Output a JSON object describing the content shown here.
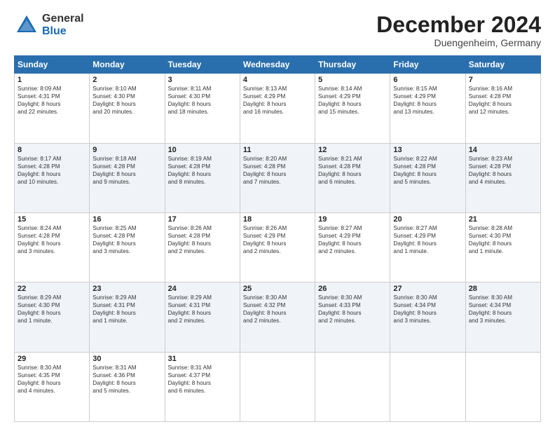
{
  "header": {
    "logo_general": "General",
    "logo_blue": "Blue",
    "month_title": "December 2024",
    "location": "Duengenheim, Germany"
  },
  "days_of_week": [
    "Sunday",
    "Monday",
    "Tuesday",
    "Wednesday",
    "Thursday",
    "Friday",
    "Saturday"
  ],
  "weeks": [
    [
      {
        "day": "1",
        "lines": [
          "Sunrise: 8:09 AM",
          "Sunset: 4:31 PM",
          "Daylight: 8 hours",
          "and 22 minutes."
        ]
      },
      {
        "day": "2",
        "lines": [
          "Sunrise: 8:10 AM",
          "Sunset: 4:30 PM",
          "Daylight: 8 hours",
          "and 20 minutes."
        ]
      },
      {
        "day": "3",
        "lines": [
          "Sunrise: 8:11 AM",
          "Sunset: 4:30 PM",
          "Daylight: 8 hours",
          "and 18 minutes."
        ]
      },
      {
        "day": "4",
        "lines": [
          "Sunrise: 8:13 AM",
          "Sunset: 4:29 PM",
          "Daylight: 8 hours",
          "and 16 minutes."
        ]
      },
      {
        "day": "5",
        "lines": [
          "Sunrise: 8:14 AM",
          "Sunset: 4:29 PM",
          "Daylight: 8 hours",
          "and 15 minutes."
        ]
      },
      {
        "day": "6",
        "lines": [
          "Sunrise: 8:15 AM",
          "Sunset: 4:29 PM",
          "Daylight: 8 hours",
          "and 13 minutes."
        ]
      },
      {
        "day": "7",
        "lines": [
          "Sunrise: 8:16 AM",
          "Sunset: 4:28 PM",
          "Daylight: 8 hours",
          "and 12 minutes."
        ]
      }
    ],
    [
      {
        "day": "8",
        "lines": [
          "Sunrise: 8:17 AM",
          "Sunset: 4:28 PM",
          "Daylight: 8 hours",
          "and 10 minutes."
        ]
      },
      {
        "day": "9",
        "lines": [
          "Sunrise: 8:18 AM",
          "Sunset: 4:28 PM",
          "Daylight: 8 hours",
          "and 9 minutes."
        ]
      },
      {
        "day": "10",
        "lines": [
          "Sunrise: 8:19 AM",
          "Sunset: 4:28 PM",
          "Daylight: 8 hours",
          "and 8 minutes."
        ]
      },
      {
        "day": "11",
        "lines": [
          "Sunrise: 8:20 AM",
          "Sunset: 4:28 PM",
          "Daylight: 8 hours",
          "and 7 minutes."
        ]
      },
      {
        "day": "12",
        "lines": [
          "Sunrise: 8:21 AM",
          "Sunset: 4:28 PM",
          "Daylight: 8 hours",
          "and 6 minutes."
        ]
      },
      {
        "day": "13",
        "lines": [
          "Sunrise: 8:22 AM",
          "Sunset: 4:28 PM",
          "Daylight: 8 hours",
          "and 5 minutes."
        ]
      },
      {
        "day": "14",
        "lines": [
          "Sunrise: 8:23 AM",
          "Sunset: 4:28 PM",
          "Daylight: 8 hours",
          "and 4 minutes."
        ]
      }
    ],
    [
      {
        "day": "15",
        "lines": [
          "Sunrise: 8:24 AM",
          "Sunset: 4:28 PM",
          "Daylight: 8 hours",
          "and 3 minutes."
        ]
      },
      {
        "day": "16",
        "lines": [
          "Sunrise: 8:25 AM",
          "Sunset: 4:28 PM",
          "Daylight: 8 hours",
          "and 3 minutes."
        ]
      },
      {
        "day": "17",
        "lines": [
          "Sunrise: 8:26 AM",
          "Sunset: 4:28 PM",
          "Daylight: 8 hours",
          "and 2 minutes."
        ]
      },
      {
        "day": "18",
        "lines": [
          "Sunrise: 8:26 AM",
          "Sunset: 4:29 PM",
          "Daylight: 8 hours",
          "and 2 minutes."
        ]
      },
      {
        "day": "19",
        "lines": [
          "Sunrise: 8:27 AM",
          "Sunset: 4:29 PM",
          "Daylight: 8 hours",
          "and 2 minutes."
        ]
      },
      {
        "day": "20",
        "lines": [
          "Sunrise: 8:27 AM",
          "Sunset: 4:29 PM",
          "Daylight: 8 hours",
          "and 1 minute."
        ]
      },
      {
        "day": "21",
        "lines": [
          "Sunrise: 8:28 AM",
          "Sunset: 4:30 PM",
          "Daylight: 8 hours",
          "and 1 minute."
        ]
      }
    ],
    [
      {
        "day": "22",
        "lines": [
          "Sunrise: 8:29 AM",
          "Sunset: 4:30 PM",
          "Daylight: 8 hours",
          "and 1 minute."
        ]
      },
      {
        "day": "23",
        "lines": [
          "Sunrise: 8:29 AM",
          "Sunset: 4:31 PM",
          "Daylight: 8 hours",
          "and 1 minute."
        ]
      },
      {
        "day": "24",
        "lines": [
          "Sunrise: 8:29 AM",
          "Sunset: 4:31 PM",
          "Daylight: 8 hours",
          "and 2 minutes."
        ]
      },
      {
        "day": "25",
        "lines": [
          "Sunrise: 8:30 AM",
          "Sunset: 4:32 PM",
          "Daylight: 8 hours",
          "and 2 minutes."
        ]
      },
      {
        "day": "26",
        "lines": [
          "Sunrise: 8:30 AM",
          "Sunset: 4:33 PM",
          "Daylight: 8 hours",
          "and 2 minutes."
        ]
      },
      {
        "day": "27",
        "lines": [
          "Sunrise: 8:30 AM",
          "Sunset: 4:34 PM",
          "Daylight: 8 hours",
          "and 3 minutes."
        ]
      },
      {
        "day": "28",
        "lines": [
          "Sunrise: 8:30 AM",
          "Sunset: 4:34 PM",
          "Daylight: 8 hours",
          "and 3 minutes."
        ]
      }
    ],
    [
      {
        "day": "29",
        "lines": [
          "Sunrise: 8:30 AM",
          "Sunset: 4:35 PM",
          "Daylight: 8 hours",
          "and 4 minutes."
        ]
      },
      {
        "day": "30",
        "lines": [
          "Sunrise: 8:31 AM",
          "Sunset: 4:36 PM",
          "Daylight: 8 hours",
          "and 5 minutes."
        ]
      },
      {
        "day": "31",
        "lines": [
          "Sunrise: 8:31 AM",
          "Sunset: 4:37 PM",
          "Daylight: 8 hours",
          "and 6 minutes."
        ]
      },
      null,
      null,
      null,
      null
    ]
  ]
}
